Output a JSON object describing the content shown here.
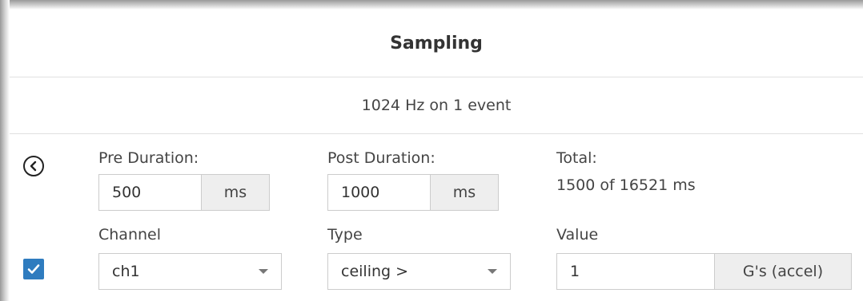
{
  "header": {
    "title": "Sampling"
  },
  "summary": {
    "text": "1024 Hz on 1 event"
  },
  "pre_duration": {
    "label": "Pre Duration:",
    "value": "500",
    "unit": "ms"
  },
  "post_duration": {
    "label": "Post Duration:",
    "value": "1000",
    "unit": "ms"
  },
  "total": {
    "label": "Total:",
    "value": "1500 of 16521 ms"
  },
  "channel": {
    "label": "Channel",
    "selected": "ch1"
  },
  "type": {
    "label": "Type",
    "selected": "ceiling >"
  },
  "value": {
    "label": "Value",
    "value": "1",
    "unit": "G's (accel)"
  },
  "trigger_enabled": true,
  "colors": {
    "accent": "#2f7cbf",
    "border": "#cccccc",
    "addon_bg": "#eeeeee"
  },
  "icons": {
    "back": "chevron-left-circle-icon",
    "check": "checkmark-icon",
    "dropdown": "caret-down-icon"
  }
}
